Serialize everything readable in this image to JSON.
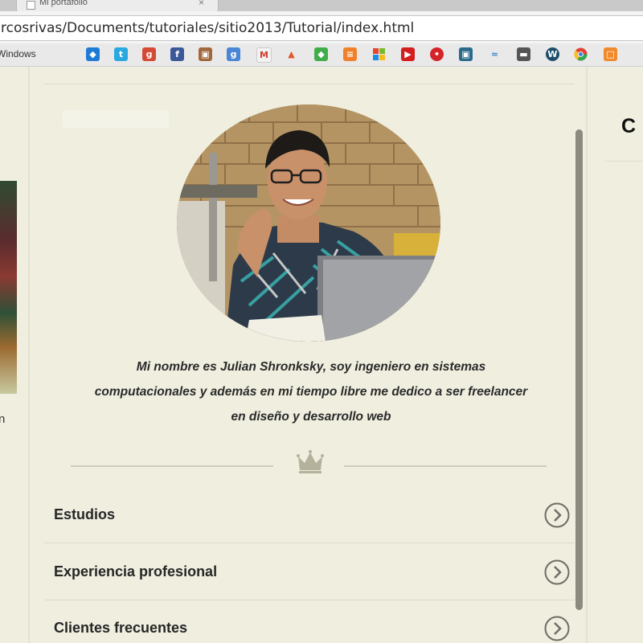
{
  "browser": {
    "tab_title": "Mi portafolio",
    "tab_close": "×",
    "url": "rcosrivas/Documents/tutoriales/sitio2013/Tutorial/index.html",
    "bookmark_label": "Windows",
    "bookmark_icons": [
      "dropbox-icon",
      "twitter-icon",
      "google-plus-icon",
      "facebook-icon",
      "photo-icon",
      "google-icon",
      "gmail-icon",
      "flame-icon",
      "feedly-icon",
      "stack-icon",
      "windows-icon",
      "youtube-icon",
      "lastpass-icon",
      "app-icon",
      "wave-icon",
      "film-icon",
      "wordpress-icon",
      "chrome-icon",
      "square-icon"
    ]
  },
  "profile": {
    "bio_line1": "Mi nombre es Julian Shronksky, soy ingeniero en sistemas",
    "bio_line2": "computacionales y además en mi tiempo libre me dedico a ser freelancer",
    "bio_line3": "en diseño y desarrollo web"
  },
  "sections": [
    {
      "label": "Estudios"
    },
    {
      "label": "Experiencia profesional"
    },
    {
      "label": "Clientes frecuentes"
    }
  ],
  "left_column": {
    "fragment": "n"
  },
  "right_column": {
    "heading": "C"
  }
}
